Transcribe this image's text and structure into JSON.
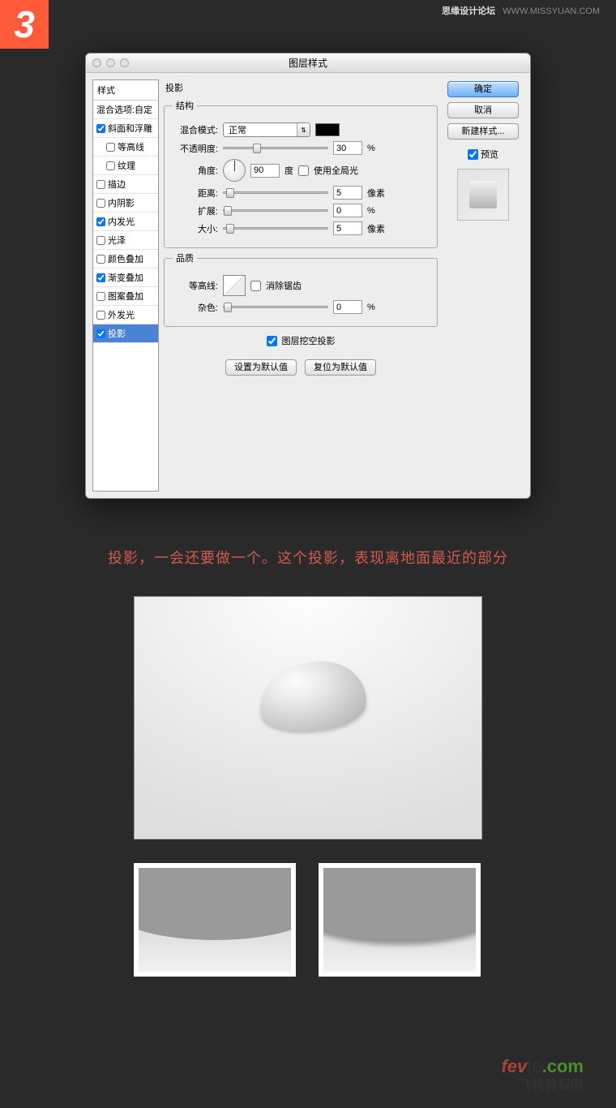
{
  "step_number": "3",
  "top_meta": {
    "forum": "思缘设计论坛",
    "url": "WWW.MISSYUAN.COM"
  },
  "dialog": {
    "title": "图层样式",
    "styles_header": "样式",
    "blend_options": "混合选项:自定",
    "items": [
      {
        "label": "斜面和浮雕",
        "checked": true
      },
      {
        "label": "等高线",
        "checked": false,
        "sub": true
      },
      {
        "label": "纹理",
        "checked": false,
        "sub": true
      },
      {
        "label": "描边",
        "checked": false
      },
      {
        "label": "内阴影",
        "checked": false
      },
      {
        "label": "内发光",
        "checked": true
      },
      {
        "label": "光泽",
        "checked": false
      },
      {
        "label": "颜色叠加",
        "checked": false
      },
      {
        "label": "渐变叠加",
        "checked": true
      },
      {
        "label": "图案叠加",
        "checked": false
      },
      {
        "label": "外发光",
        "checked": false
      },
      {
        "label": "投影",
        "checked": true,
        "selected": true
      }
    ],
    "section": "投影",
    "groups": {
      "structure": {
        "legend": "结构",
        "blend_mode_label": "混合模式:",
        "blend_mode_value": "正常",
        "opacity_label": "不透明度:",
        "opacity_value": "30",
        "opacity_unit": "%",
        "angle_label": "角度:",
        "angle_value": "90",
        "angle_unit": "度",
        "global_light_label": "使用全局光",
        "distance_label": "距离:",
        "distance_value": "5",
        "distance_unit": "像素",
        "spread_label": "扩展:",
        "spread_value": "0",
        "spread_unit": "%",
        "size_label": "大小:",
        "size_value": "5",
        "size_unit": "像素"
      },
      "quality": {
        "legend": "品质",
        "contour_label": "等高线:",
        "antialias_label": "消除锯齿",
        "noise_label": "杂色:",
        "noise_value": "0",
        "noise_unit": "%"
      },
      "knockout_label": "图层挖空投影",
      "btn_default": "设置为默认值",
      "btn_reset": "复位为默认值"
    },
    "buttons": {
      "ok": "确定",
      "cancel": "取消",
      "new_style": "新建样式...",
      "preview": "预览"
    }
  },
  "caption": "投影，一会还要做一个。这个投影，表现离地面最近的部分",
  "footer": {
    "brand_pre": "fev",
    "brand_mid": "te",
    "brand_suf": ".com",
    "sub": "飞特教程网"
  }
}
